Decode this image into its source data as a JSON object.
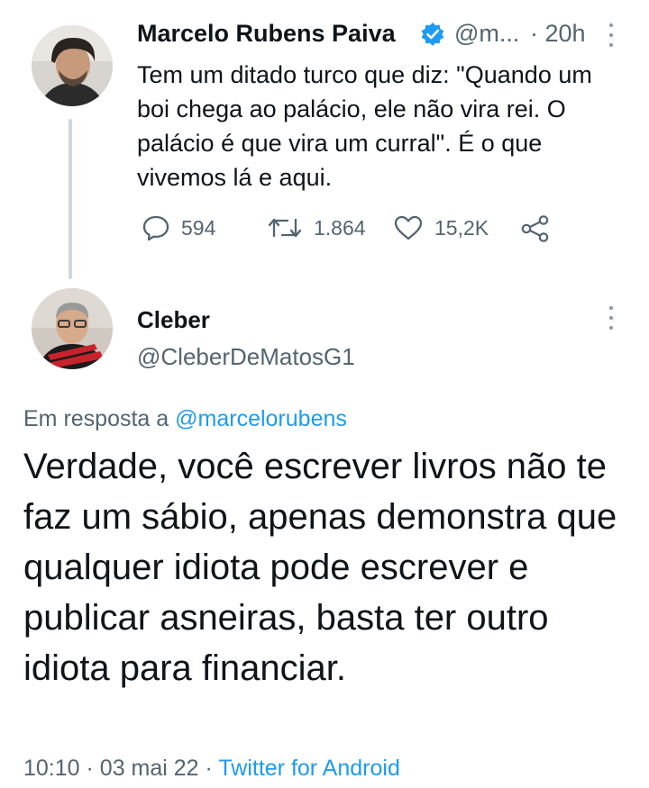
{
  "tweet1": {
    "author_name": "Marcelo Rubens Paiva",
    "handle": "@m...",
    "separator": "·",
    "time": "20h",
    "text": "Tem um ditado turco que diz: \"Quando um boi chega ao palácio, ele não vira rei. O palácio é que vira um curral\". É o que vivemos lá e aqui.",
    "replies": "594",
    "retweets": "1.864",
    "likes": "15,2K"
  },
  "tweet2": {
    "author_name": "Cleber",
    "handle": "@CleberDeMatosG1",
    "reply_prefix": "Em resposta a",
    "reply_mention": "@marcelorubens",
    "text": "Verdade, você escrever livros não te faz um sábio, apenas demonstra que qualquer idiota pode escrever e publicar asneiras, basta ter outro idiota para financiar.",
    "time": "10:10",
    "separator": "·",
    "date": "03 mai 22",
    "source": "Twitter for Android"
  },
  "icons": {
    "verified": "verified-badge-icon",
    "more": "more-vertical-icon",
    "reply": "reply-icon",
    "retweet": "retweet-icon",
    "like": "heart-icon",
    "share": "share-icon"
  },
  "colors": {
    "accent": "#1d9bf0",
    "secondary_text": "#536471",
    "primary_text": "#0f1419",
    "thread_line": "#cfd9de"
  }
}
